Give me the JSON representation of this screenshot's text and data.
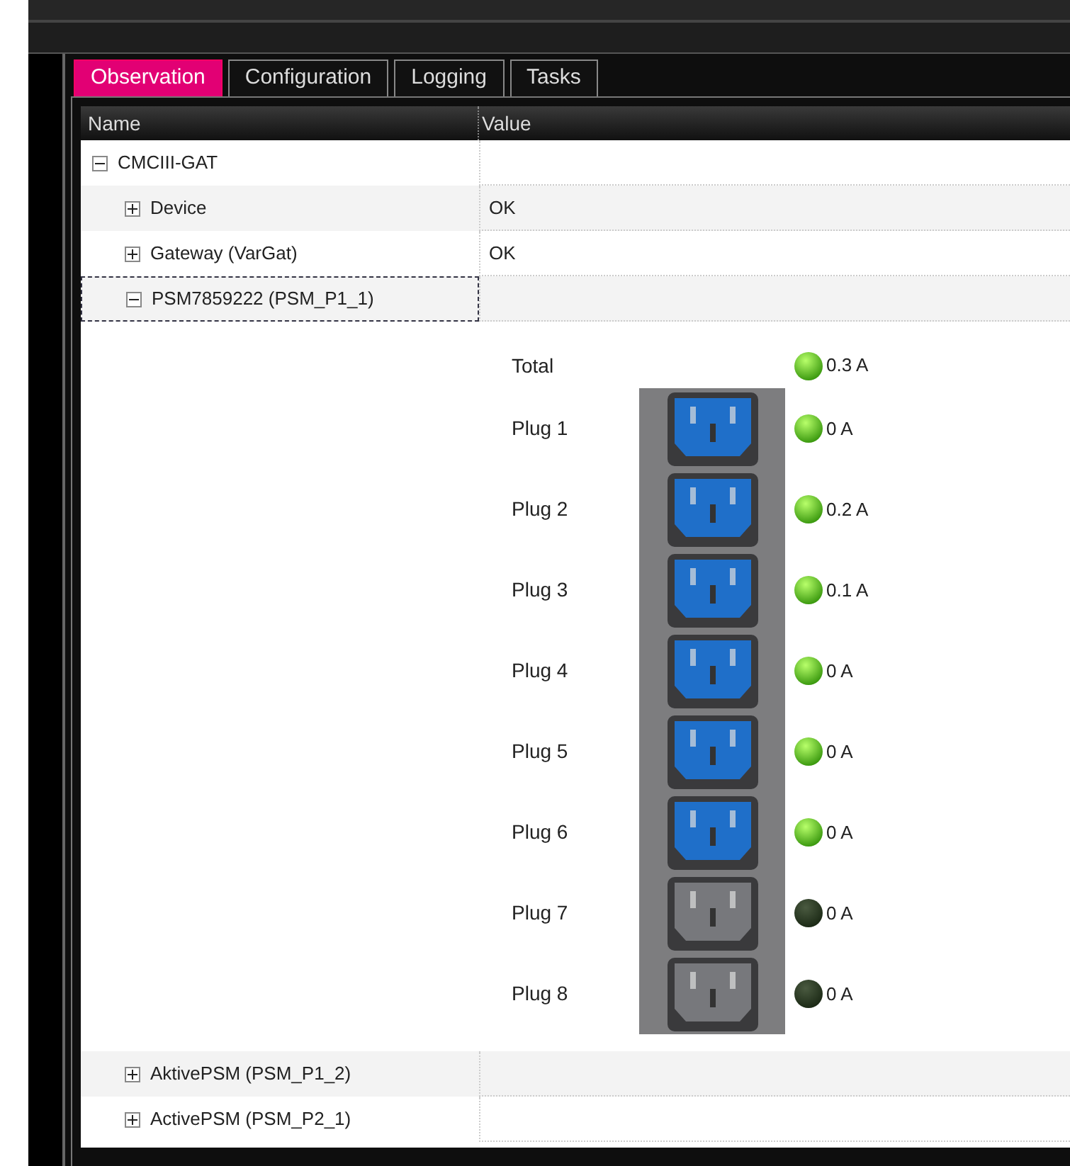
{
  "tabs": [
    {
      "label": "Observation",
      "selected": true
    },
    {
      "label": "Configuration",
      "selected": false
    },
    {
      "label": "Logging",
      "selected": false
    },
    {
      "label": "Tasks",
      "selected": false
    }
  ],
  "table": {
    "columns": [
      "Name",
      "Value"
    ],
    "rows_top": [
      {
        "name": "CMCIII-GAT",
        "expanded": true,
        "children": [
          {
            "name": "Device",
            "expanded": false,
            "value": "OK"
          },
          {
            "name": "Gateway (VarGat)",
            "expanded": false,
            "value": "OK"
          },
          {
            "name": "PSM7859222 (PSM_P1_1)",
            "expanded": true,
            "focused": true
          }
        ]
      }
    ]
  },
  "psm_detail": {
    "total": {
      "label": "Total",
      "on": true,
      "reading": "0.3 A"
    },
    "plugs": [
      {
        "label": "Plug 1",
        "on": true,
        "reading": "0 A"
      },
      {
        "label": "Plug 2",
        "on": true,
        "reading": "0.2 A"
      },
      {
        "label": "Plug 3",
        "on": true,
        "reading": "0.1 A"
      },
      {
        "label": "Plug 4",
        "on": true,
        "reading": "0 A"
      },
      {
        "label": "Plug 5",
        "on": true,
        "reading": "0 A"
      },
      {
        "label": "Plug 6",
        "on": true,
        "reading": "0 A"
      },
      {
        "label": "Plug 7",
        "on": false,
        "reading": "0 A"
      },
      {
        "label": "Plug 8",
        "on": false,
        "reading": "0 A"
      }
    ]
  },
  "rows_bottom": [
    {
      "name": "AktivePSM (PSM_P1_2)",
      "expanded": false
    },
    {
      "name": "ActivePSM (PSM_P2_1)",
      "expanded": false
    }
  ]
}
